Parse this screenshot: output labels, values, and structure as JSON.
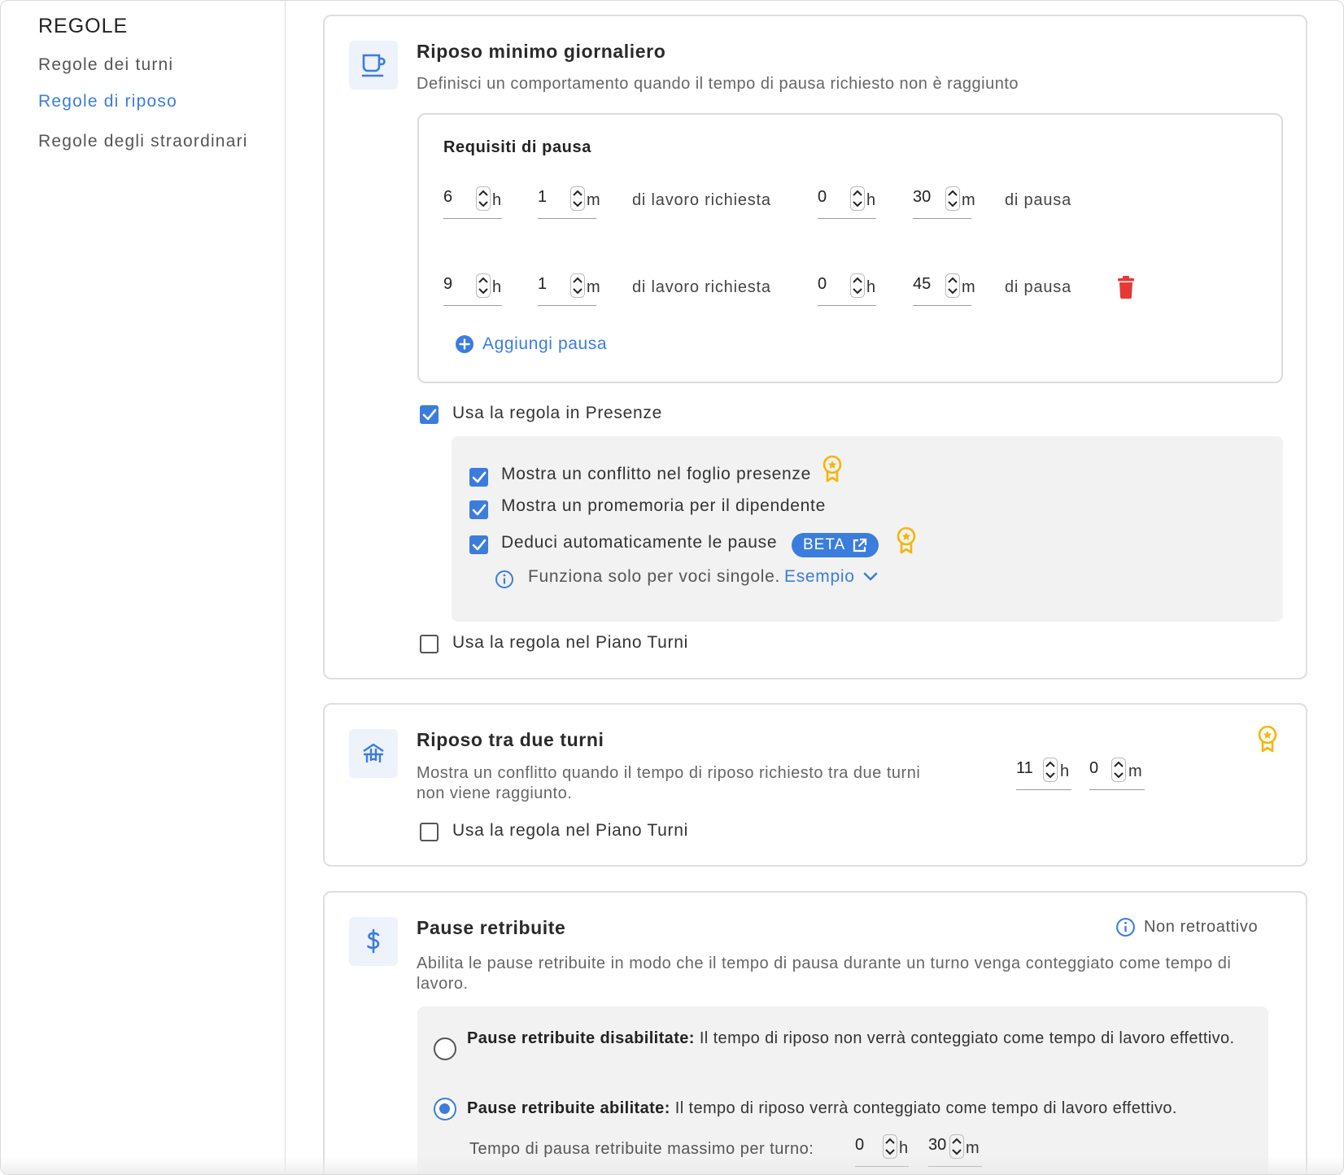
{
  "sidebar": {
    "title": "REGOLE",
    "items": [
      {
        "label": "Regole dei turni"
      },
      {
        "label": "Regole di riposo"
      },
      {
        "label": "Regole degli straordinari"
      }
    ]
  },
  "min_rest": {
    "title": "Riposo minimo giornaliero",
    "description": "Definisci un comportamento quando il tempo di pausa richiesto non è raggiunto",
    "requirements_title": "Requisiti di pausa",
    "rows": [
      {
        "work_h": "6",
        "work_m": "1",
        "mid_text": "di lavoro richiesta",
        "break_h": "0",
        "break_m": "30",
        "end_text": "di pausa"
      },
      {
        "work_h": "9",
        "work_m": "1",
        "mid_text": "di lavoro richiesta",
        "break_h": "0",
        "break_m": "45",
        "end_text": "di pausa"
      }
    ],
    "unit_h": "h",
    "unit_m": "m",
    "add_break": "Aggiungi pausa",
    "use_in_attendance": "Usa la regola in Presenze",
    "use_in_attendance_checked": true,
    "options": [
      {
        "label": "Mostra un conflitto nel foglio presenze",
        "checked": true
      },
      {
        "label": "Mostra un promemoria per il dipendente",
        "checked": true
      },
      {
        "label": "Deduci automaticamente le pause",
        "checked": true
      }
    ],
    "beta_label": "BETA",
    "info_text": "Funziona solo per voci singole.",
    "example_link": "Esempio",
    "use_in_schedule": "Usa la regola nel Piano Turni",
    "use_in_schedule_checked": false
  },
  "between_shifts": {
    "title": "Riposo tra due turni",
    "description": "Mostra un conflitto quando il tempo di riposo richiesto tra due turni non viene raggiunto.",
    "hours": "11",
    "minutes": "0",
    "use_in_schedule": "Usa la regola nel Piano Turni",
    "use_in_schedule_checked": false
  },
  "paid_breaks": {
    "title": "Pause retribuite",
    "non_retroactive": "Non retroattivo",
    "description": "Abilita le pause retribuite in modo che il tempo di pausa durante un turno venga conteggiato come tempo di lavoro.",
    "options": [
      {
        "bold": "Pause retribuite disabilitate:",
        "text": "Il tempo di riposo non verrà conteggiato come tempo di lavoro effettivo.",
        "selected": false
      },
      {
        "bold": "Pause retribuite abilitate:",
        "text": "Il tempo di riposo verrà conteggiato come tempo di lavoro effettivo.",
        "selected": true
      }
    ],
    "max_label": "Tempo di pausa retribuite massimo per turno:",
    "max_h": "0",
    "max_m": "30"
  },
  "colors": {
    "accent": "#3b7ddd",
    "danger": "#e53935",
    "award": "#f5b50a",
    "panel": "#f2f2f2"
  },
  "icons": [
    "coffee-cup-icon",
    "bench-icon",
    "dollar-icon",
    "trash-icon",
    "plus-circle-icon",
    "award-icon",
    "external-link-icon",
    "info-icon",
    "chevron-down-icon",
    "check-icon",
    "spinner-arrows-icon"
  ]
}
